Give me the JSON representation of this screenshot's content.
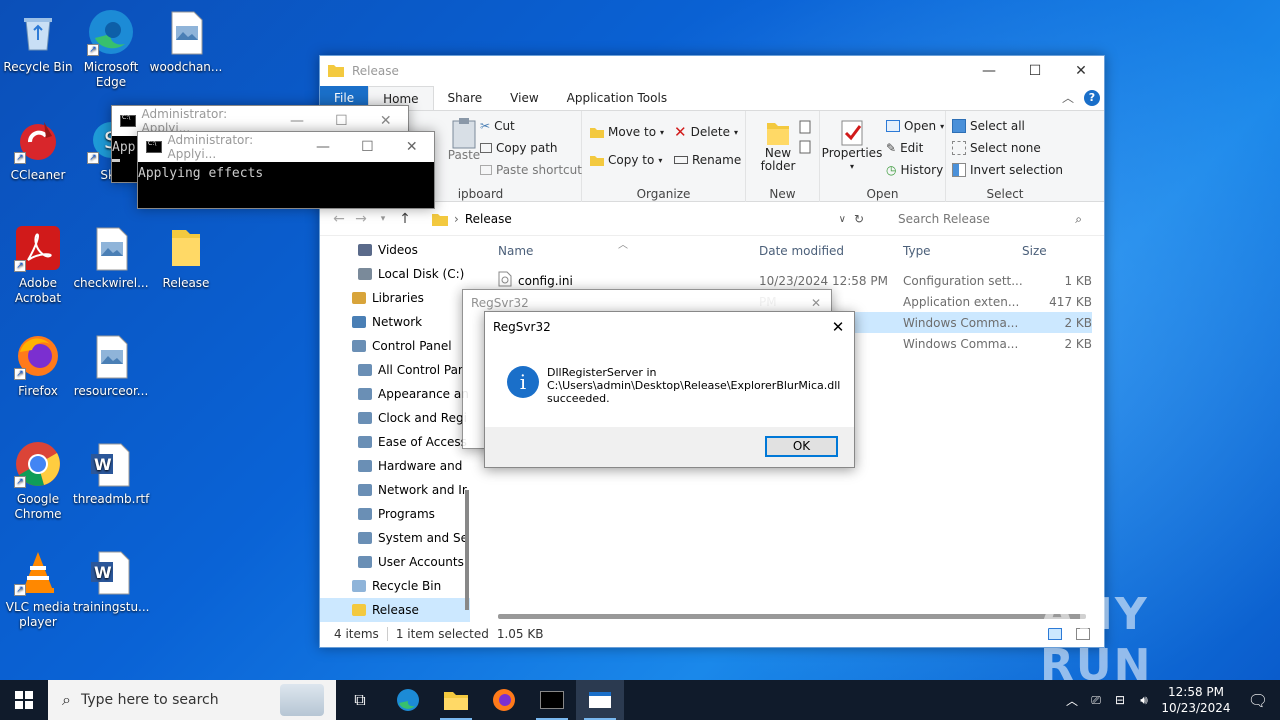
{
  "desktop": {
    "icons": [
      {
        "name": "recycle-bin-icon",
        "label": "Recycle Bin"
      },
      {
        "name": "microsoft-edge-icon",
        "label": "Microsoft Edge"
      },
      {
        "name": "woodchan-file-icon",
        "label": "woodchan..."
      },
      {
        "name": "ccleaner-icon",
        "label": "CCleaner"
      },
      {
        "name": "skype-icon",
        "label": "Sky"
      },
      {
        "name": "adobe-acrobat-icon",
        "label": "Adobe Acrobat"
      },
      {
        "name": "checkwirel-file-icon",
        "label": "checkwirel..."
      },
      {
        "name": "release-folder-icon",
        "label": "Release"
      },
      {
        "name": "firefox-icon",
        "label": "Firefox"
      },
      {
        "name": "resourceor-file-icon",
        "label": "resourceor..."
      },
      {
        "name": "google-chrome-icon",
        "label": "Google Chrome"
      },
      {
        "name": "threadmb-word-icon",
        "label": "threadmb.rtf"
      },
      {
        "name": "vlc-icon",
        "label": "VLC media player"
      },
      {
        "name": "trainingstu-word-icon",
        "label": "trainingstu..."
      }
    ]
  },
  "cmd_back": {
    "title": "Administrator: Applyi...",
    "text": "App"
  },
  "cmd_front": {
    "title": "Administrator: Applyi...",
    "text": "Applying effects"
  },
  "explorer": {
    "title": "Release",
    "tabs": [
      "File",
      "Home",
      "Share",
      "View",
      "Application Tools"
    ],
    "ribbon": {
      "clipboard": {
        "paste": "Paste",
        "cut": "Cut",
        "copy_path": "Copy path",
        "paste_shortcut": "Paste shortcut",
        "group": "ipboard"
      },
      "organize": {
        "move_to": "Move to",
        "copy_to": "Copy to",
        "delete": "Delete",
        "rename": "Rename",
        "group": "Organize"
      },
      "new": {
        "new_folder": "New folder",
        "group": "New"
      },
      "open": {
        "properties": "Properties",
        "open": "Open",
        "edit": "Edit",
        "history": "History",
        "group": "Open"
      },
      "select": {
        "select_all": "Select all",
        "select_none": "Select none",
        "invert": "Invert selection",
        "group": "Select"
      }
    },
    "address": {
      "path": "Release",
      "search_placeholder": "Search Release"
    },
    "nav": [
      {
        "label": "Videos",
        "icon": "videos-icon"
      },
      {
        "label": "Local Disk (C:)",
        "icon": "disk-icon"
      },
      {
        "label": "Libraries",
        "icon": "libraries-icon"
      },
      {
        "label": "Network",
        "icon": "network-icon"
      },
      {
        "label": "Control Panel",
        "icon": "control-panel-icon"
      },
      {
        "label": "All Control Par",
        "icon": "control-panel-icon"
      },
      {
        "label": "Appearance an",
        "icon": "appearance-icon"
      },
      {
        "label": "Clock and Regi",
        "icon": "clock-icon"
      },
      {
        "label": "Ease of Access",
        "icon": "ease-of-access-icon"
      },
      {
        "label": "Hardware and",
        "icon": "hardware-icon"
      },
      {
        "label": "Network and Ir",
        "icon": "network-internet-icon"
      },
      {
        "label": "Programs",
        "icon": "programs-icon"
      },
      {
        "label": "System and Se",
        "icon": "system-security-icon"
      },
      {
        "label": "User Accounts",
        "icon": "user-accounts-icon"
      },
      {
        "label": "Recycle Bin",
        "icon": "recycle-bin-icon"
      },
      {
        "label": "Release",
        "icon": "folder-icon"
      }
    ],
    "columns": {
      "name": "Name",
      "date": "Date modified",
      "type": "Type",
      "size": "Size"
    },
    "files": [
      {
        "name": "config.ini",
        "date": "10/23/2024 12:58 PM",
        "type": "Configuration sett...",
        "size": "1 KB"
      },
      {
        "name": "",
        "date": "PM",
        "type": "Application exten...",
        "size": "417 KB"
      },
      {
        "name": "",
        "date": "",
        "type": "Windows Comma...",
        "size": "2 KB"
      },
      {
        "name": "",
        "date": "",
        "type": "Windows Comma...",
        "size": "2 KB"
      }
    ],
    "status": {
      "items": "4 items",
      "selected": "1 item selected",
      "size": "1.05 KB"
    }
  },
  "regsvr_back": {
    "title": "RegSvr32"
  },
  "regsvr": {
    "title": "RegSvr32",
    "line1": "DllRegisterServer in",
    "line2": "C:\\Users\\admin\\Desktop\\Release\\ExplorerBlurMica.dll",
    "line3": "succeeded.",
    "ok": "OK"
  },
  "taskbar": {
    "search_placeholder": "Type here to search",
    "time": "12:58 PM",
    "date": "10/23/2024"
  },
  "watermark": {
    "text": "ANY RUN"
  }
}
